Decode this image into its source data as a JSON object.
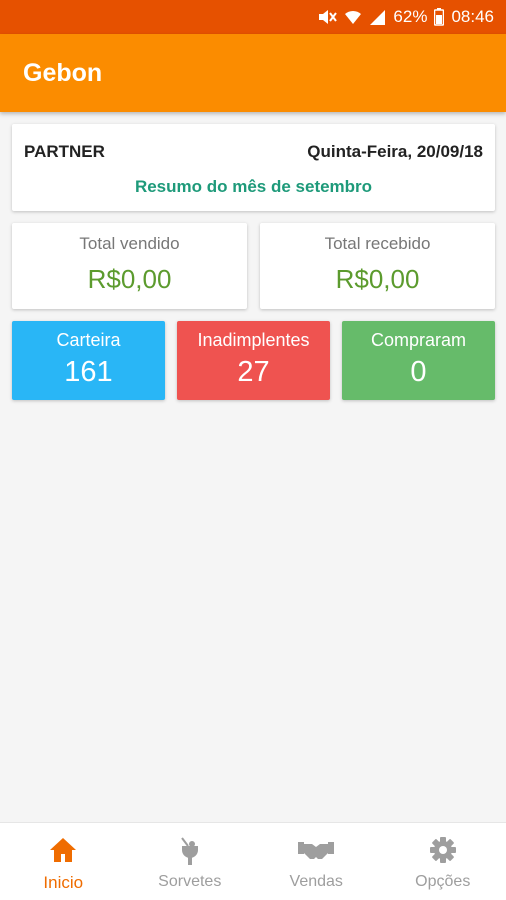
{
  "status_bar": {
    "battery": "62%",
    "time": "08:46"
  },
  "app": {
    "title": "Gebon"
  },
  "summary": {
    "partner": "PARTNER",
    "date": "Quinta-Feira, 20/09/18",
    "subtitle": "Resumo do mês de setembro"
  },
  "totals": {
    "sold_label": "Total vendido",
    "sold_value": "R$0,00",
    "received_label": "Total recebido",
    "received_value": "R$0,00"
  },
  "stats": {
    "wallet_label": "Carteira",
    "wallet_value": "161",
    "defaulters_label": "Inadimplentes",
    "defaulters_value": "27",
    "bought_label": "Compraram",
    "bought_value": "0"
  },
  "bottom_nav": {
    "items": [
      {
        "label": "Inicio",
        "icon": "home-icon",
        "active": true
      },
      {
        "label": "Sorvetes",
        "icon": "ice-cream-icon",
        "active": false
      },
      {
        "label": "Vendas",
        "icon": "handshake-icon",
        "active": false
      },
      {
        "label": "Opções",
        "icon": "gear-icon",
        "active": false
      }
    ]
  },
  "colors": {
    "status_bar": "#e65100",
    "app_bar": "#fb8c00",
    "subtitle": "#1e9a7a",
    "money": "#5c9b2e",
    "wallet": "#29b6f6",
    "defaulters": "#ef5350",
    "bought": "#66bb6a",
    "nav_active": "#ef6c00",
    "nav_inactive": "#9e9e9e"
  }
}
